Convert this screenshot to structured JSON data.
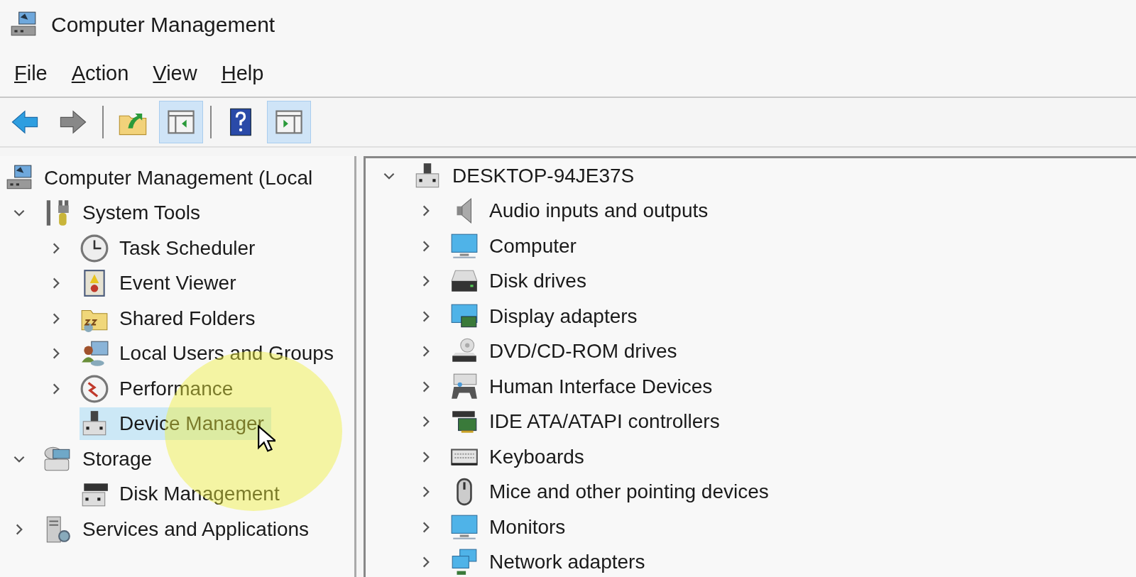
{
  "window": {
    "title": "Computer Management"
  },
  "menu": [
    {
      "label": "File"
    },
    {
      "label": "Action"
    },
    {
      "label": "View"
    },
    {
      "label": "Help"
    }
  ],
  "toolbar": [
    {
      "kind": "back",
      "pressed": false
    },
    {
      "kind": "forward",
      "pressed": false
    },
    {
      "kind": "separator"
    },
    {
      "kind": "up",
      "pressed": false
    },
    {
      "kind": "tree",
      "pressed": true
    },
    {
      "kind": "separator"
    },
    {
      "kind": "help",
      "pressed": false
    },
    {
      "kind": "actions",
      "pressed": true
    }
  ],
  "left_tree": [
    {
      "label": "Computer Management (Local",
      "selected": false,
      "children": [
        {
          "label": "System Tools",
          "expanded": true,
          "selected": false,
          "children": [
            {
              "label": "Task Scheduler",
              "expanded": false,
              "selected": false
            },
            {
              "label": "Event Viewer",
              "expanded": false,
              "selected": false
            },
            {
              "label": "Shared Folders",
              "expanded": false,
              "selected": false
            },
            {
              "label": "Local Users and Groups",
              "expanded": false,
              "selected": false
            },
            {
              "label": "Performance",
              "expanded": false,
              "selected": false
            },
            {
              "label": "Device Manager",
              "selected": true
            }
          ]
        },
        {
          "label": "Storage",
          "expanded": true,
          "selected": false,
          "children": [
            {
              "label": "Disk Management",
              "selected": false
            }
          ]
        },
        {
          "label": "Services and Applications",
          "expanded": false,
          "selected": false
        }
      ]
    }
  ],
  "device_tree": [
    {
      "label": "DESKTOP-94JE37S",
      "expanded": true,
      "children": [
        {
          "label": "Audio inputs and outputs",
          "expanded": false
        },
        {
          "label": "Computer",
          "expanded": false
        },
        {
          "label": "Disk drives",
          "expanded": false
        },
        {
          "label": "Display adapters",
          "expanded": false
        },
        {
          "label": "DVD/CD-ROM drives",
          "expanded": false
        },
        {
          "label": "Human Interface Devices",
          "expanded": false
        },
        {
          "label": "IDE ATA/ATAPI controllers",
          "expanded": false
        },
        {
          "label": "Keyboards",
          "expanded": false
        },
        {
          "label": "Mice and other pointing devices",
          "expanded": false
        },
        {
          "label": "Monitors",
          "expanded": false
        },
        {
          "label": "Network adapters",
          "expanded": false
        }
      ]
    }
  ]
}
